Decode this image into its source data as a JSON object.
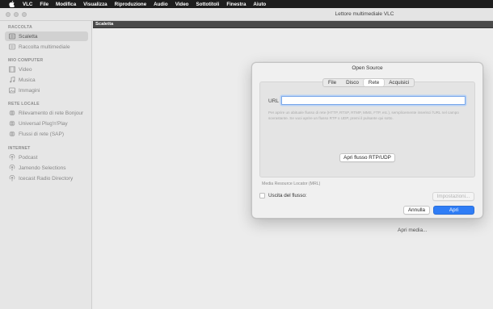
{
  "menubar": {
    "app": "VLC",
    "items": [
      "File",
      "Modifica",
      "Visualizza",
      "Riproduzione",
      "Audio",
      "Video",
      "Sottotitoli",
      "Finestra",
      "Aiuto"
    ]
  },
  "window": {
    "title": "Lettore multimediale VLC"
  },
  "sidebar": {
    "sections": [
      {
        "title": "RACCOLTA",
        "items": [
          {
            "label": "Scaletta",
            "icon": "playlist-icon",
            "selected": true
          },
          {
            "label": "Raccolta multimediale",
            "icon": "library-icon"
          }
        ]
      },
      {
        "title": "MIO COMPUTER",
        "items": [
          {
            "label": "Video",
            "icon": "film-icon"
          },
          {
            "label": "Musica",
            "icon": "music-note-icon"
          },
          {
            "label": "Immagini",
            "icon": "image-icon"
          }
        ]
      },
      {
        "title": "RETE LOCALE",
        "items": [
          {
            "label": "Rilevamento di rete Bonjour",
            "icon": "globe-icon"
          },
          {
            "label": "Universal Plug'n'Play",
            "icon": "globe-icon"
          },
          {
            "label": "Flussi di rete (SAP)",
            "icon": "globe-icon"
          }
        ]
      },
      {
        "title": "INTERNET",
        "items": [
          {
            "label": "Podcast",
            "icon": "podcast-icon"
          },
          {
            "label": "Jamendo Selections",
            "icon": "podcast-icon"
          },
          {
            "label": "Icecast Radio Directory",
            "icon": "podcast-icon"
          }
        ]
      }
    ]
  },
  "playlist": {
    "header": "Scaletta",
    "open_media": "Apri media..."
  },
  "dialog": {
    "title": "Open Source",
    "tabs": [
      {
        "label": "File"
      },
      {
        "label": "Disco"
      },
      {
        "label": "Rete",
        "active": true
      },
      {
        "label": "Acquisici"
      }
    ],
    "url_label": "URL",
    "url_value": "",
    "hint": "Per aprire un abituale flusso di rete (HTTP, RTSP, RTMP, MMS, FTP, etc.), semplicemente inserisci l'URL nel campo sovrastante. Se vuoi aprire un flusso RTP o UDP, premi il pulsante qui sotto.",
    "stream_button": "Apri flusso RTP/UDP",
    "mrl": "Media Resource Locator (MRL)",
    "output_label": "Uscita del flusso:",
    "settings_button": "Impostazioni...",
    "cancel_button": "Annulla",
    "open_button": "Apri"
  },
  "colors": {
    "accent": "#2f7df6",
    "menubar": "#1e1e1e",
    "playlist_header": "#4a4a4a"
  }
}
